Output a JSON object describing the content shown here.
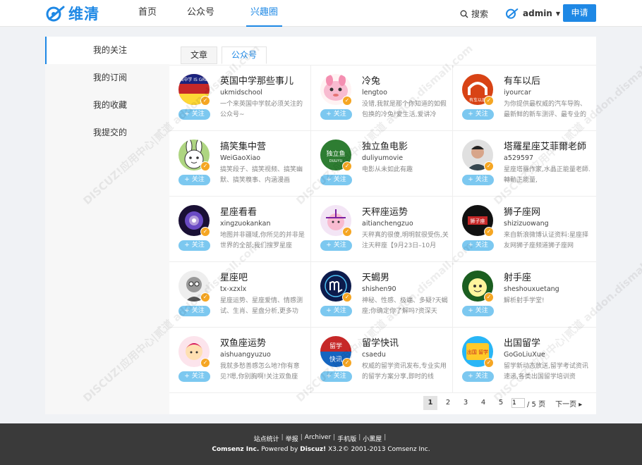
{
  "header": {
    "logo_text": "维清",
    "nav": [
      "首页",
      "公众号",
      "兴趣圈"
    ],
    "search_label": "搜索",
    "user_name": "admin",
    "apply_label": "申请",
    "brand_color": "#1e88e5"
  },
  "sidebar": {
    "items": [
      "我的关注",
      "我的订阅",
      "我的收藏",
      "我提交的"
    ]
  },
  "tabs": [
    "文章",
    "公众号"
  ],
  "follow_label": "+ 关注",
  "cards": [
    {
      "name": "英国中学那些事儿",
      "id": "ukmidschool",
      "desc": "一个来英国中学就必须关注的公众号~"
    },
    {
      "name": "冷兔",
      "id": "lengtoo",
      "desc": "没错,我就是那个你知道的如假包换的冷兔!爱生活,爱讲冷"
    },
    {
      "name": "有车以后",
      "id": "iyourcar",
      "desc": "为你提供最权威的汽车导购、最新鲜的新车测评、最专业的"
    },
    {
      "name": "搞笑集中营",
      "id": "WeiGaoXiao",
      "desc": "搞笑段子、搞笑视频、搞笑幽默、搞笑糗事、内涵漫画"
    },
    {
      "name": "独立鱼电影",
      "id": "duliyumovie",
      "desc": "电影从未如此有趣"
    },
    {
      "name": "塔羅星座艾菲爾老師",
      "id": "a529597",
      "desc": "星座塔羅作家,水晶正能量老師.轉動正能量,"
    },
    {
      "name": "星座看看",
      "id": "xingzuokankan",
      "desc": "地图并非疆域,你所见的并非是世界的全部;我们搜罗星座"
    },
    {
      "name": "天秤座运势",
      "id": "aitianchengzuo",
      "desc": "天秤真的很傻,明明就很受伤,关注天秤座【9月23日–10月"
    },
    {
      "name": "狮子座网",
      "id": "shizizuowang",
      "desc": "来自新浪微博认证资料:星座择友网狮子座频道狮子座网"
    },
    {
      "name": "星座吧",
      "id": "tx-xzxlx",
      "desc": "星座运势、星座爱情、情感测试、生肖、星盘分析,更多功"
    },
    {
      "name": "天蝎男",
      "id": "shishen90",
      "desc": "神秘、性感、极端、多疑?天蝎座;你确定你了解吗?资深天"
    },
    {
      "name": "射手座",
      "id": "sheshouxuetang",
      "desc": "解析射手学堂!"
    },
    {
      "name": "双鱼座运势",
      "id": "aishuangyuzuo",
      "desc": "我就多愁善感怎么地?你有意见?嗯,你别胸啊!关注双鱼座"
    },
    {
      "name": "留学快讯",
      "id": "csaedu",
      "desc": "权威的留学资讯发布,专业实用的留学方案分享,即时的线"
    },
    {
      "name": "出国留学",
      "id": "GoGoLiuXue",
      "desc": "留学新动态放送,留学考试资讯速递,各类出国留学培训资"
    }
  ],
  "avatar_labels": {
    "a1_text": "英国中学 IS GREAT",
    "a3_text": "有车以后",
    "a5_text": "独立鱼",
    "a5_sub": "DULIYU",
    "a9_text": "狮子座",
    "a14_line1": "留学",
    "a14_line2": "快讯",
    "a15_text": "出国 留学"
  },
  "watermark": "DISCUZ!应用中心|贰道 addon.dismall.com",
  "pager": {
    "pages": [
      "1",
      "2",
      "3",
      "4",
      "5"
    ],
    "current_input": "1",
    "total": "/ 5 页",
    "next": "下一页"
  },
  "footer": {
    "links": [
      "站点统计",
      "举报",
      "Archiver",
      "手机版",
      "小黑屋"
    ],
    "brand": "Comsenz Inc.",
    "powered": "Powered by",
    "product": "Discuz!",
    "copyright": "X3.2© 2001-2013 Comsenz Inc."
  }
}
